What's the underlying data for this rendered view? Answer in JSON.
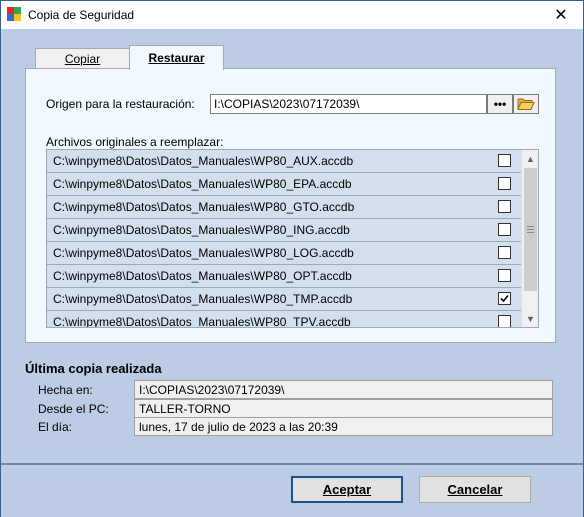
{
  "window": {
    "title": "Copia de Seguridad",
    "close_glyph": "✕",
    "icon": "app-four-squares-icon",
    "icon_colors": [
      "#e8262a",
      "#2fa84f",
      "#2b6fd6",
      "#f5c518"
    ]
  },
  "tabs": [
    {
      "label": "Copiar",
      "active": false
    },
    {
      "label": "Restaurar",
      "active": true
    }
  ],
  "restore": {
    "origin_label": "Origen para la restauración:",
    "origin_value": "I:\\COPIAS\\2023\\07172039\\",
    "browse_label": "•••",
    "folder_icon": "open-folder-icon",
    "files_label": "Archivos originales a reemplazar:",
    "files": [
      {
        "path": "C:\\winpyme8\\Datos\\Datos_Manuales\\WP80_AUX.accdb",
        "checked": false
      },
      {
        "path": "C:\\winpyme8\\Datos\\Datos_Manuales\\WP80_EPA.accdb",
        "checked": false
      },
      {
        "path": "C:\\winpyme8\\Datos\\Datos_Manuales\\WP80_GTO.accdb",
        "checked": false
      },
      {
        "path": "C:\\winpyme8\\Datos\\Datos_Manuales\\WP80_ING.accdb",
        "checked": false
      },
      {
        "path": "C:\\winpyme8\\Datos\\Datos_Manuales\\WP80_LOG.accdb",
        "checked": false
      },
      {
        "path": "C:\\winpyme8\\Datos\\Datos_Manuales\\WP80_OPT.accdb",
        "checked": false
      },
      {
        "path": "C:\\winpyme8\\Datos\\Datos_Manuales\\WP80_TMP.accdb",
        "checked": true
      },
      {
        "path": "C:\\winpyme8\\Datos\\Datos_Manuales\\WP80_TPV.accdb",
        "checked": false
      }
    ]
  },
  "last_copy": {
    "title": "Última copia realizada",
    "made_in_label": "Hecha en:",
    "made_in_value": "I:\\COPIAS\\2023\\07172039\\",
    "from_pc_label": "Desde el PC:",
    "from_pc_value": "TALLER-TORNO",
    "day_label": "El día:",
    "day_value": "lunes, 17 de julio de 2023 a las 20:39"
  },
  "buttons": {
    "accept": "Aceptar",
    "cancel": "Cancelar"
  },
  "check_glyph": "☑"
}
